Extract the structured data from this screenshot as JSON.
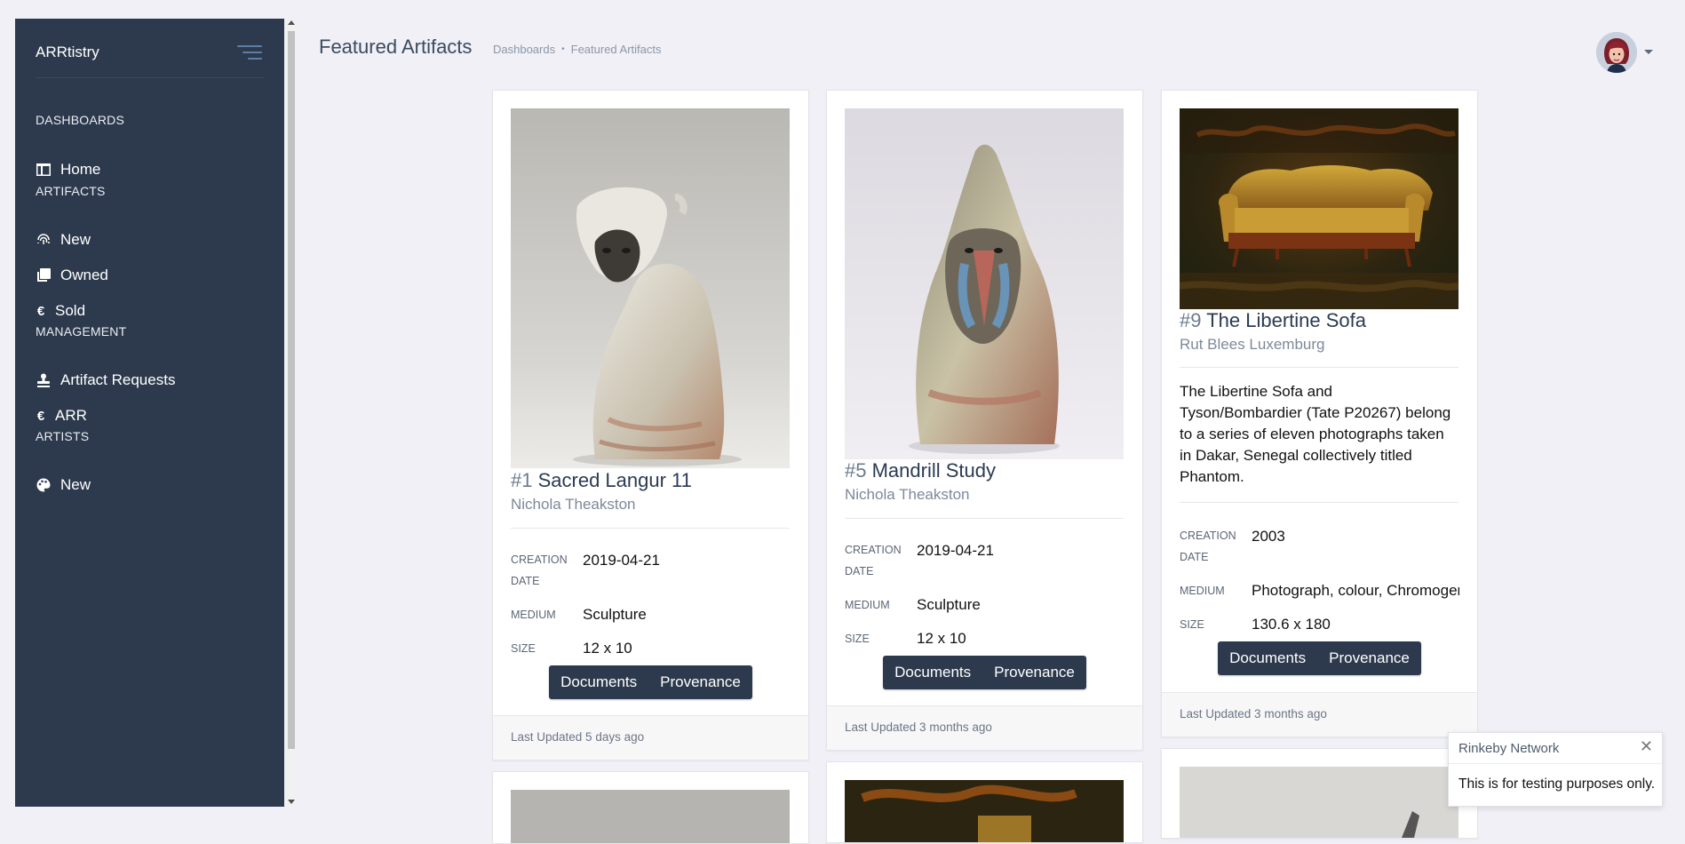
{
  "app": {
    "brand": "ARRtistry"
  },
  "sidebar": {
    "sections": [
      {
        "label": "DASHBOARDS"
      },
      {
        "label": "ARTIFACTS"
      },
      {
        "label": "MANAGEMENT"
      },
      {
        "label": "ARTISTS"
      }
    ],
    "items": [
      {
        "label": "Home",
        "icon": "table-icon"
      },
      {
        "label": "New",
        "icon": "fingerprint-icon"
      },
      {
        "label": "Owned",
        "icon": "clone-icon"
      },
      {
        "label": "Sold",
        "icon": "euro-icon"
      },
      {
        "label": "Artifact Requests",
        "icon": "stamp-icon"
      },
      {
        "label": "ARR",
        "icon": "euro-icon"
      },
      {
        "label": "New",
        "icon": "palette-icon"
      }
    ]
  },
  "header": {
    "title": "Featured Artifacts",
    "breadcrumb": [
      "Dashboards",
      "Featured Artifacts"
    ]
  },
  "fields": {
    "creation_date_label": "CREATION DATE",
    "medium_label": "MEDIUM",
    "size_label": "SIZE",
    "documents_label": "Documents",
    "provenance_label": "Provenance"
  },
  "cards": [
    {
      "number": "#1",
      "title": "Sacred Langur 11",
      "artist": "Nichola Theakston",
      "creation_date": "2019-04-21",
      "medium": "Sculpture",
      "size": "12 x 10",
      "updated": "Last Updated 5 days ago"
    },
    {
      "number": "#5",
      "title": "Mandrill Study",
      "artist": "Nichola Theakston",
      "creation_date": "2019-04-21",
      "medium": "Sculpture",
      "size": "12 x 10",
      "updated": "Last Updated 3 months ago"
    },
    {
      "number": "#9",
      "title": "The Libertine Sofa",
      "artist": "Rut Blees Luxemburg",
      "description": "The Libertine Sofa and Tyson/Bombardier (Tate P20267) belong to a series of eleven photographs taken in Dakar, Senegal collectively titled Phantom.",
      "creation_date": "2003",
      "medium": "Photograph, colour, Chromogenic print",
      "size": "130.6 x 180",
      "updated": "Last Updated 3 months ago"
    }
  ],
  "toast": {
    "title": "Rinkeby Network",
    "message": "This is for testing purposes only.",
    "close": "✕"
  }
}
